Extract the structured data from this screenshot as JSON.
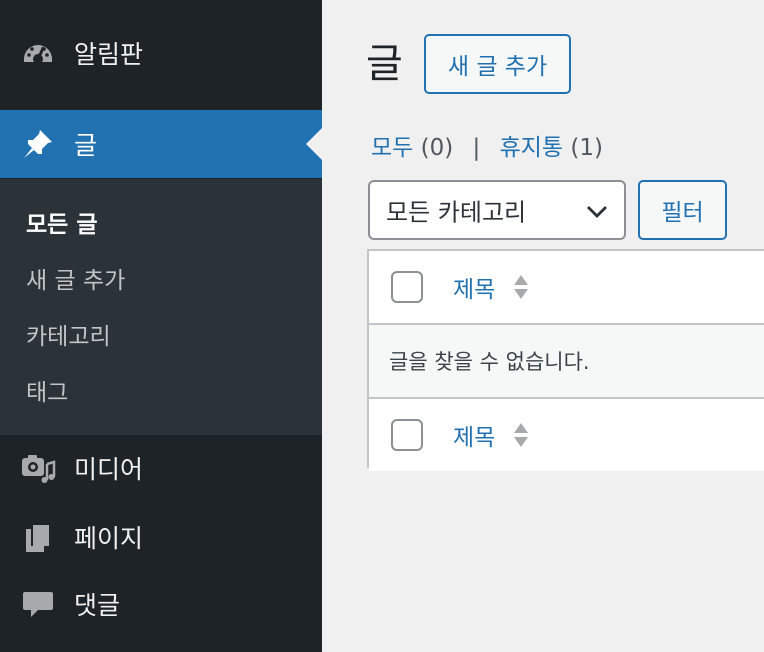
{
  "sidebar": {
    "menu": [
      {
        "label": "알림판",
        "icon": "dashboard-icon"
      },
      {
        "label": "글",
        "icon": "pin-icon",
        "current": true
      },
      {
        "label": "미디어",
        "icon": "media-icon"
      },
      {
        "label": "페이지",
        "icon": "pages-icon"
      },
      {
        "label": "댓글",
        "icon": "comments-icon"
      }
    ],
    "submenu": [
      {
        "label": "모든 글",
        "active": true
      },
      {
        "label": "새 글 추가"
      },
      {
        "label": "카테고리"
      },
      {
        "label": "태그"
      }
    ]
  },
  "header": {
    "title": "글",
    "add_new_label": "새 글 추가"
  },
  "views": {
    "all_label": "모두",
    "all_count": "(0)",
    "separator": "|",
    "trash_label": "휴지통",
    "trash_count": "(1)"
  },
  "filters": {
    "category_selected": "모든 카테고리",
    "filter_button": "필터"
  },
  "table": {
    "column_title": "제목",
    "empty_message": "글을 찾을 수 없습니다.",
    "footer_column_title": "제목"
  },
  "colors": {
    "sidebar_bg": "#1d2327",
    "submenu_bg": "#2c3338",
    "accent": "#2271b1",
    "page_bg": "#f0f0f1"
  }
}
